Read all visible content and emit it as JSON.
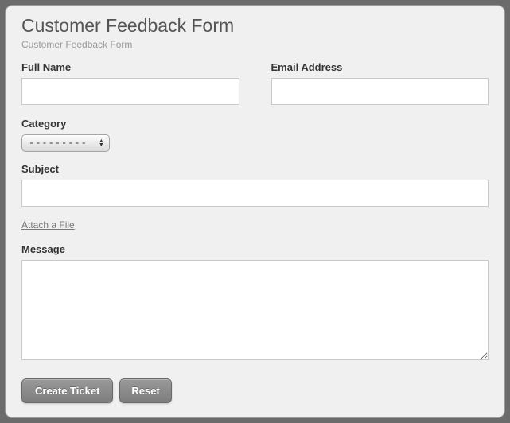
{
  "header": {
    "title": "Customer Feedback Form",
    "subtitle": "Customer Feedback Form"
  },
  "fields": {
    "full_name": {
      "label": "Full Name",
      "value": ""
    },
    "email": {
      "label": "Email Address",
      "value": ""
    },
    "category": {
      "label": "Category",
      "selected": "---------"
    },
    "subject": {
      "label": "Subject",
      "value": ""
    },
    "attach": {
      "label": "Attach a File"
    },
    "message": {
      "label": "Message",
      "value": ""
    }
  },
  "buttons": {
    "create": "Create Ticket",
    "reset": "Reset"
  }
}
